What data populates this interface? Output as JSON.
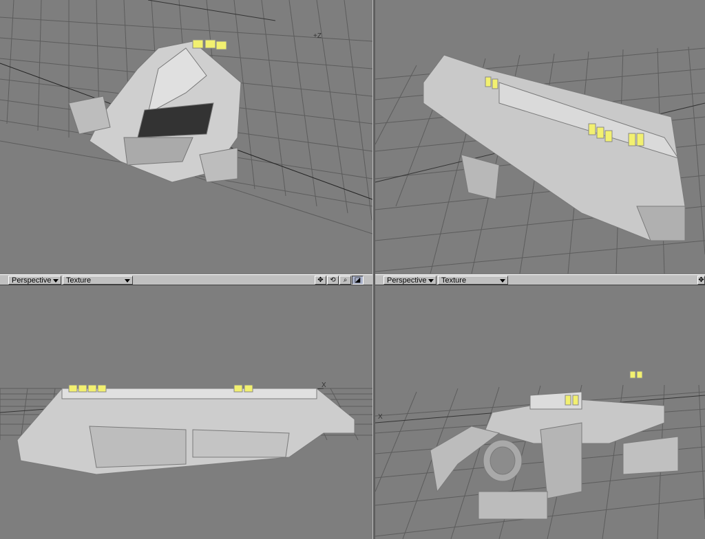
{
  "viewports": {
    "top_left": {
      "axis_label": "+Z"
    },
    "bottom_left": {
      "header": {
        "view_mode": "Perspective",
        "shading_mode": "Texture"
      },
      "axis_label": "X"
    },
    "bottom_right": {
      "header": {
        "view_mode": "Perspective",
        "shading_mode": "Texture"
      },
      "axis_label": "X"
    }
  },
  "toolbar_icons": [
    "move-view-icon",
    "rotate-view-icon",
    "zoom-view-icon",
    "maximize-view-icon"
  ],
  "colors": {
    "viewport_bg": "#7e7e7e",
    "grid": "#5a5a5a",
    "model": "#c8c8c8",
    "window_light": "#f2f070"
  }
}
